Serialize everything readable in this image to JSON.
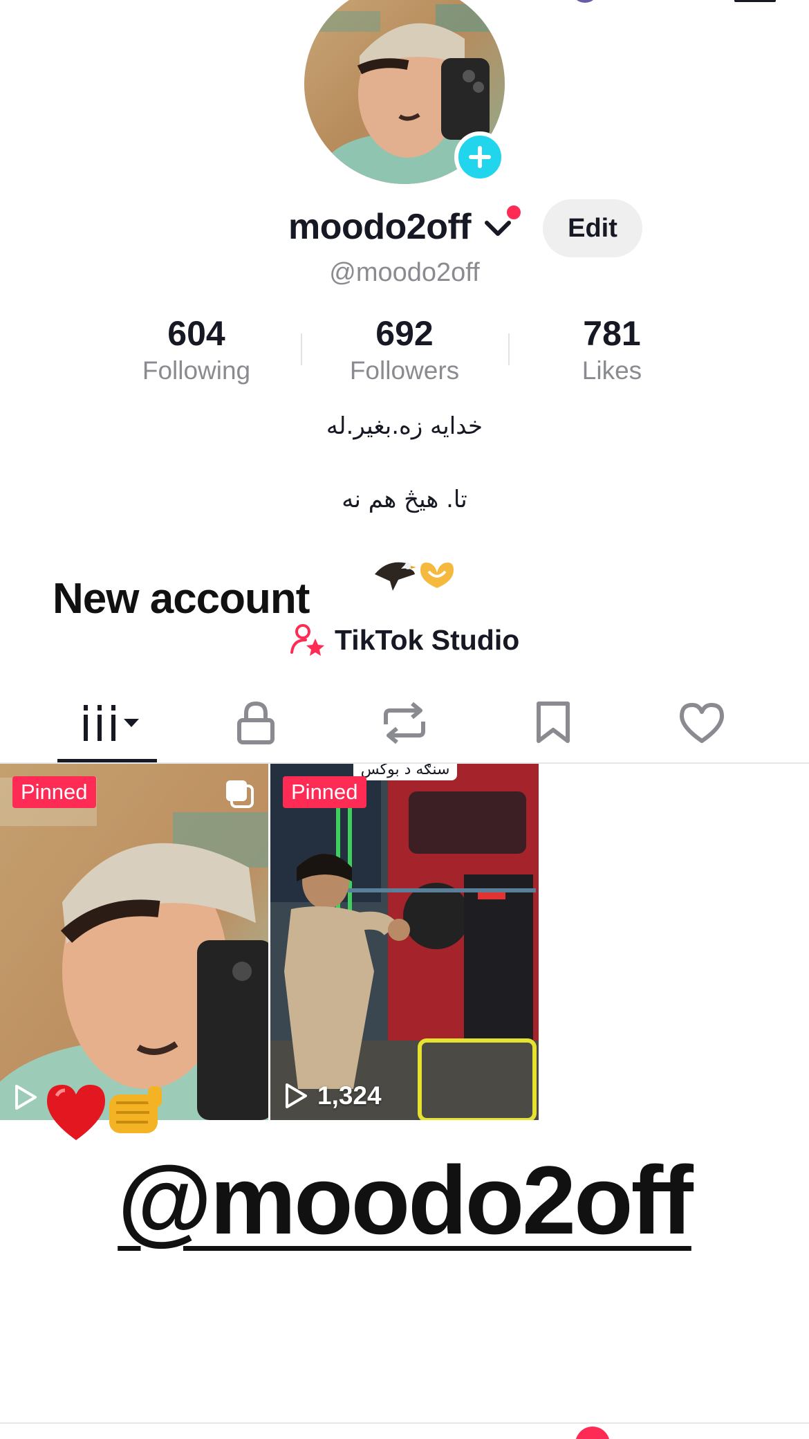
{
  "profile": {
    "display_name": "moodo2off",
    "handle": "@moodo2off",
    "edit_label": "Edit"
  },
  "stats": {
    "following": {
      "value": "604",
      "label": "Following"
    },
    "followers": {
      "value": "692",
      "label": "Followers"
    },
    "likes": {
      "value": "781",
      "label": "Likes"
    }
  },
  "bio": {
    "line1": "خدایه زه.بغیر.له",
    "line2": "تا.    هیڅ هم نه",
    "emojis": "🦅🫶",
    "headline": "New account"
  },
  "studio_link": {
    "label": "TikTok Studio",
    "icon": "person-star-icon"
  },
  "tabs": [
    {
      "name": "videos",
      "icon": "grid-icon",
      "active": true
    },
    {
      "name": "private",
      "icon": "lock-icon"
    },
    {
      "name": "reposts",
      "icon": "repost-icon"
    },
    {
      "name": "favorites",
      "icon": "bookmark-icon"
    },
    {
      "name": "liked",
      "icon": "heart-icon"
    }
  ],
  "videos": [
    {
      "badge": "Pinned",
      "views": "",
      "multi_photo": true,
      "sticker": "❤️👊"
    },
    {
      "badge": "Pinned",
      "views": "1,324",
      "caption": "سنګه د بوکس"
    }
  ],
  "watermark": "@moodo2off",
  "colors": {
    "accent": "#fe2c55",
    "avatar_add": "#20d5ec",
    "text": "#161823",
    "muted": "#8a8b91"
  }
}
